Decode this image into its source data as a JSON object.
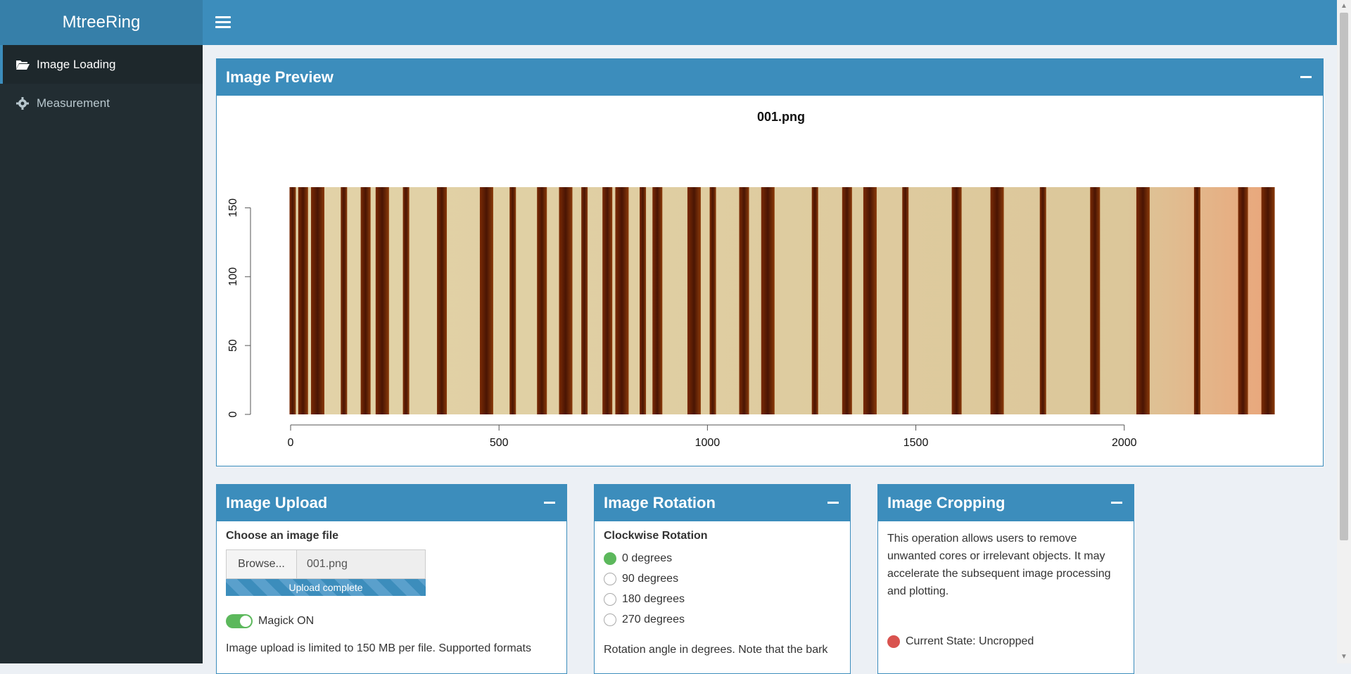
{
  "app": {
    "title": "MtreeRing"
  },
  "sidebar": {
    "items": [
      {
        "label": "Image Loading",
        "icon": "folder-open-icon",
        "active": true
      },
      {
        "label": "Measurement",
        "icon": "gear-icon",
        "active": false
      }
    ]
  },
  "preview": {
    "title": "Image Preview",
    "chart_data": {
      "type": "image",
      "title": "001.png",
      "xlim": [
        0,
        2360
      ],
      "ylim": [
        0,
        165
      ],
      "xticks": [
        0,
        500,
        1000,
        1500,
        2000
      ],
      "yticks": [
        0,
        50,
        100,
        150
      ],
      "dark_bands": [
        5,
        30,
        65,
        128,
        180,
        220,
        277,
        363,
        470,
        533,
        603,
        660,
        705,
        760,
        795,
        845,
        880,
        968,
        1013,
        1088,
        1145,
        1258,
        1335,
        1390,
        1475,
        1598,
        1695,
        1805,
        1930,
        2045,
        2175,
        2285,
        2345
      ]
    }
  },
  "upload": {
    "title": "Image Upload",
    "label": "Choose an image file",
    "browse": "Browse...",
    "filename": "001.png",
    "progress_text": "Upload complete",
    "progress": 1.0,
    "magick": "Magick ON",
    "note": "Image upload is limited to 150 MB per file. Supported formats"
  },
  "rotation": {
    "title": "Image Rotation",
    "label": "Clockwise Rotation",
    "options": [
      "0 degrees",
      "90 degrees",
      "180 degrees",
      "270 degrees"
    ],
    "selected": "0 degrees",
    "note": "Rotation angle in degrees. Note that the bark"
  },
  "cropping": {
    "title": "Image Cropping",
    "desc": "This operation allows users to remove unwanted cores or irrelevant objects. It may accelerate the subsequent image processing and plotting.",
    "state": "Current State: Uncropped"
  },
  "colors": {
    "primary": "#3c8dbc",
    "sidebar": "#222d32",
    "success": "#5cb85c",
    "danger": "#d9534f"
  }
}
